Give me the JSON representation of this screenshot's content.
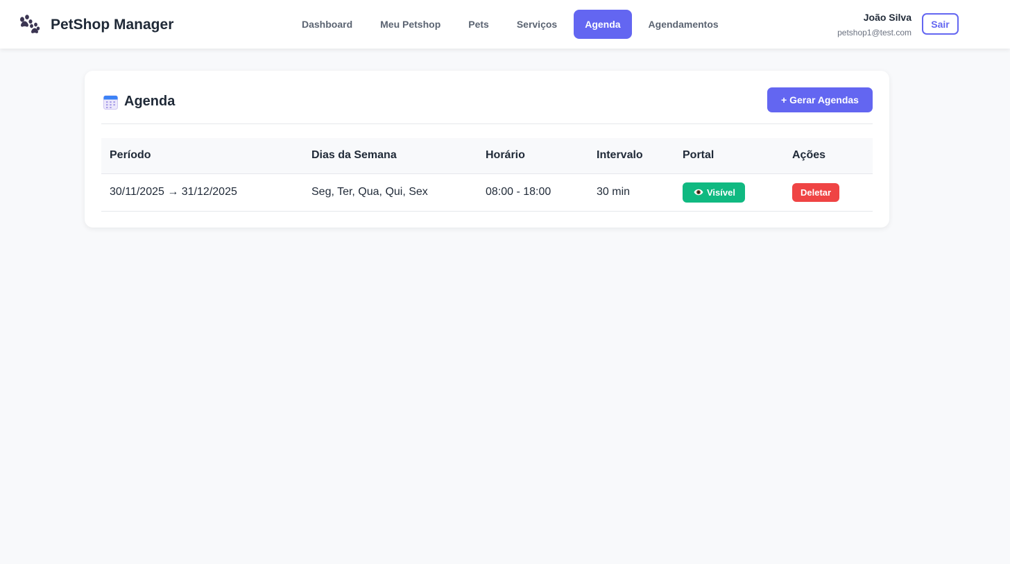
{
  "app": {
    "name": "PetShop Manager",
    "logo_icon": "paw-icon"
  },
  "nav": {
    "items": [
      {
        "label": "Dashboard",
        "active": false
      },
      {
        "label": "Meu Petshop",
        "active": false
      },
      {
        "label": "Pets",
        "active": false
      },
      {
        "label": "Serviços",
        "active": false
      },
      {
        "label": "Agenda",
        "active": true
      },
      {
        "label": "Agendamentos",
        "active": false
      }
    ]
  },
  "user": {
    "name": "João Silva",
    "email": "petshop1@test.com",
    "logout_label": "Sair"
  },
  "page": {
    "title": "Agenda",
    "title_icon": "calendar-icon",
    "generate_button_label": "+ Gerar Agendas"
  },
  "table": {
    "headers": [
      "Período",
      "Dias da Semana",
      "Horário",
      "Intervalo",
      "Portal",
      "Ações"
    ],
    "rows": [
      {
        "periodo": "30/11/2025 → 31/12/2025",
        "dias": "Seg, Ter, Qua, Qui, Sex",
        "horario": "08:00 - 18:00",
        "intervalo": "30 min",
        "portal": "Visível",
        "portal_icon": "eye-icon",
        "acao": "Deletar"
      }
    ]
  },
  "colors": {
    "primary": "#6366f1",
    "success": "#10b981",
    "danger": "#ef4444",
    "background": "#f8f9fb"
  }
}
